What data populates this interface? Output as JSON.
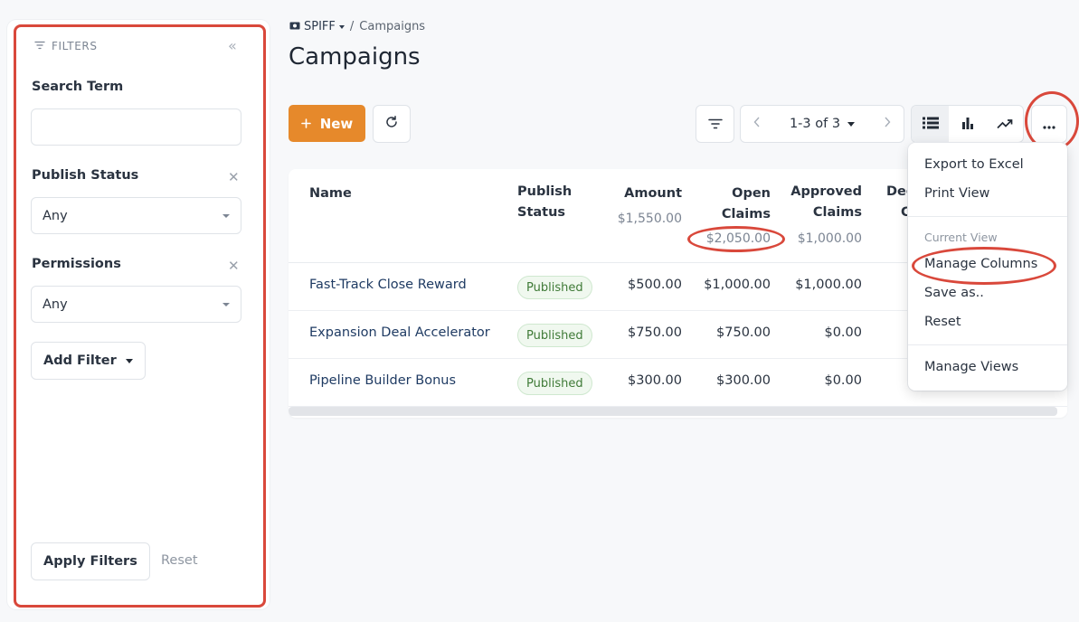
{
  "breadcrumb": {
    "root": "SPIFF",
    "separator": "/",
    "current": "Campaigns"
  },
  "page_title": "Campaigns",
  "filters": {
    "header": "FILTERS",
    "search_label": "Search Term",
    "search_value": "",
    "publish_status_label": "Publish Status",
    "publish_status_value": "Any",
    "permissions_label": "Permissions",
    "permissions_value": "Any",
    "add_filter_label": "Add Filter",
    "apply_label": "Apply Filters",
    "reset_label": "Reset"
  },
  "toolbar": {
    "new_label": "New",
    "pagination": "1-3 of 3",
    "icons": [
      "plus-icon",
      "refresh-icon",
      "filter-lines-icon",
      "chevron-left-icon",
      "chevron-right-icon",
      "list-view-icon",
      "bar-chart-icon",
      "trend-icon",
      "more-icon"
    ]
  },
  "table": {
    "columns": {
      "name": "Name",
      "publish_status_line1": "Publish",
      "publish_status_line2": "Status",
      "amount": "Amount",
      "open_claims_line1": "Open",
      "open_claims_line2": "Claims",
      "approved_claims_line1": "Approved",
      "approved_claims_line2": "Claims",
      "declined_partial_line1": "Dec",
      "declined_partial_line2": "C"
    },
    "totals": {
      "amount": "$1,550.00",
      "open_claims": "$2,050.00",
      "approved_claims": "$1,000.00"
    },
    "rows": [
      {
        "name": "Fast-Track Close Reward",
        "status": "Published",
        "amount": "$500.00",
        "open_claims": "$1,000.00",
        "approved_claims": "$1,000.00"
      },
      {
        "name": "Expansion Deal Accelerator",
        "status": "Published",
        "amount": "$750.00",
        "open_claims": "$750.00",
        "approved_claims": "$0.00"
      },
      {
        "name": "Pipeline Builder Bonus",
        "status": "Published",
        "amount": "$300.00",
        "open_claims": "$300.00",
        "approved_claims": "$0.00"
      }
    ]
  },
  "menu": {
    "export_excel": "Export to Excel",
    "print_view": "Print View",
    "section_current_view": "Current View",
    "manage_columns": "Manage Columns",
    "save_as": "Save as..",
    "reset": "Reset",
    "manage_views": "Manage Views"
  },
  "colors": {
    "accent": "#e6892b",
    "annotation": "#d9483b",
    "link": "#1f3b63",
    "badge_green": "#3f7a37"
  }
}
